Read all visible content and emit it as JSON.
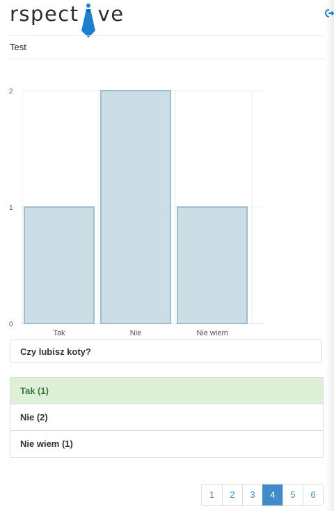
{
  "header": {
    "logo_prefix": "rspect",
    "logo_suffix": "ve",
    "logo_icon": "tie-icon",
    "logout_icon": "logout-icon"
  },
  "section": {
    "title": "Test"
  },
  "chart_data": {
    "type": "bar",
    "categories": [
      "Tak",
      "Nie",
      "Nie wiem"
    ],
    "values": [
      1,
      2,
      1
    ],
    "ylim": [
      0,
      2
    ],
    "yticks": [
      "0",
      "1",
      "2"
    ],
    "title": "",
    "xlabel": "",
    "ylabel": "",
    "bar_fill": "#cddde5",
    "bar_stroke": "#9fbdca",
    "grid": true
  },
  "question": {
    "text": "Czy lubisz koty?"
  },
  "answers": [
    {
      "label": "Tak (1)",
      "selected": true
    },
    {
      "label": "Nie (2)",
      "selected": false
    },
    {
      "label": "Nie wiem (1)",
      "selected": false
    }
  ],
  "pagination": {
    "pages": [
      "1",
      "2",
      "3",
      "4",
      "5",
      "6"
    ],
    "active": "4",
    "accent_color": "#428bca"
  },
  "colors": {
    "selected_bg": "#dff0d8",
    "selected_text": "#3c763d",
    "tie_blue": "#1e7fd1"
  }
}
